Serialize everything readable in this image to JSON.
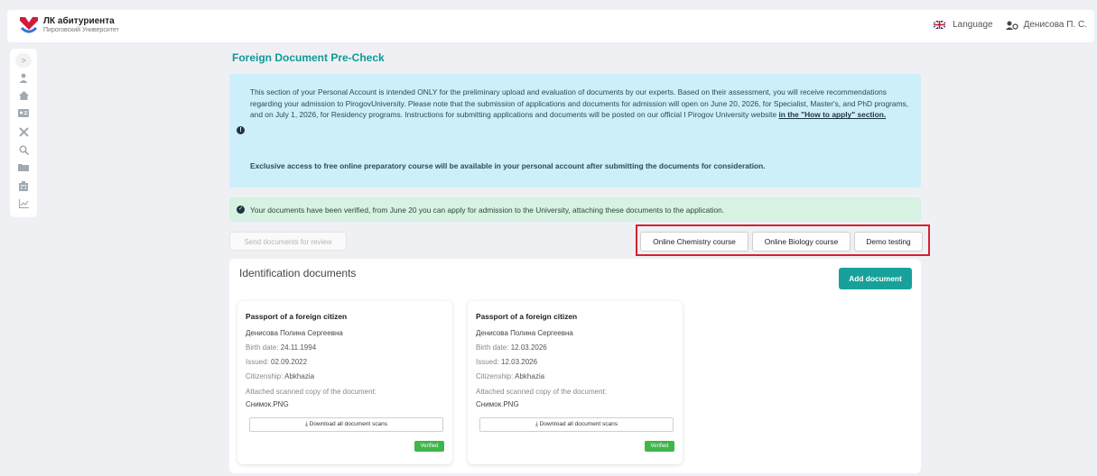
{
  "header": {
    "logo_title": "ЛК абитуриента",
    "logo_subtitle": "Пироговский Университет",
    "language_label": "Language",
    "user_name": "Денисова П. С."
  },
  "sidebar": {
    "toggle_icon": "chevron-right-icon",
    "icons": [
      "user-icon",
      "home-icon",
      "id-card-icon",
      "tools-icon",
      "search-icon",
      "folder-icon",
      "building-icon",
      "chart-icon"
    ]
  },
  "page": {
    "title": "Foreign Document Pre-Check"
  },
  "info_alert": {
    "text": "This section of your Personal Account is intended ONLY for the preliminary upload and evaluation of documents by our experts. Based on their assessment, you will receive recommendations regarding your admission to PirogovUniversity. Please note that the submission of applications and documents for admission will open on June 20, 2026, for Specialist, Master's, and PhD programs, and on July 1, 2026, for Residency programs. Instructions for submitting applications and documents will be posted on our official I Pirogov University website",
    "link_text": "in the \"How to apply\" section.",
    "note": "Exclusive access to free online preparatory course will be available in your personal account after submitting the documents for consideration."
  },
  "success_alert": {
    "text": "Your documents have been verified, from June 20 you can apply for admission to the University, attaching these documents to the application."
  },
  "actions": {
    "send_label": "Send documents for review",
    "chemistry_label": "Online Chemistry course",
    "biology_label": "Online Biology course",
    "demo_label": "Demo testing"
  },
  "documents": {
    "title": "Identification documents",
    "add_label": "Add document",
    "cards": [
      {
        "title": "Passport of a foreign citizen",
        "name": "Денисова Полина Сергеевна",
        "birth_label": "Birth date:",
        "birth": "24.11.1994",
        "issued_label": "Issued:",
        "issued": "02.09.2022",
        "citizenship_label": "Citizenship:",
        "citizenship": "Abkhazia",
        "attached_label": "Attached scanned copy of the document:",
        "file": "Снимок.PNG",
        "download_label": "Download all document scans",
        "status": "Verified"
      },
      {
        "title": "Passport of a foreign citizen",
        "name": "Денисова Полина Сергеевна",
        "birth_label": "Birth date:",
        "birth": "12.03.2026",
        "issued_label": "Issued:",
        "issued": "12.03.2026",
        "citizenship_label": "Citizenship:",
        "citizenship": "Abkhazia",
        "attached_label": "Attached scanned copy of the document:",
        "file": "Снимок.PNG",
        "download_label": "Download all document scans",
        "status": "Verified"
      }
    ]
  },
  "colors": {
    "accent": "#0f9a96",
    "add_button": "#17a19a",
    "info_bg": "#cdeff9",
    "success_bg": "#d7f1e3",
    "verified": "#3fb54a",
    "highlight_box": "#d62030",
    "logo": "#d11b3a"
  }
}
